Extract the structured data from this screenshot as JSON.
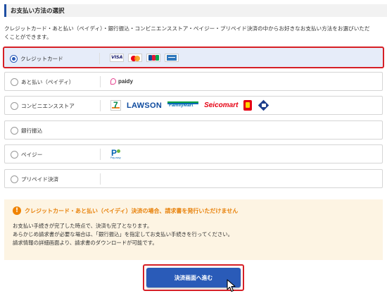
{
  "section": {
    "title": "お支払い方法の選択"
  },
  "intro": {
    "line1": "クレジットカード・あと払い（ペイディ）・銀行振込・コンビニエンスストア・ペイジー・プリペイド決済の中からお好きなお支払い方法をお選びいただ",
    "line2": "くことができます。"
  },
  "payment_options": [
    {
      "label": "クレジットカード",
      "selected": true,
      "logos": [
        "visa-icon",
        "mastercard-icon",
        "jcb-icon",
        "amex-icon"
      ]
    },
    {
      "label": "あと払い（ペイディ）",
      "selected": false,
      "logos": [
        "paidy-logo"
      ],
      "logo_text": "paidy"
    },
    {
      "label": "コンビニエンスストア",
      "selected": false,
      "logos": [
        "seven-eleven-logo",
        "lawson-logo",
        "familymart-logo",
        "seicomart-logo",
        "daily-yamazaki-logo",
        "ministop-logo"
      ],
      "lawson_text": "LAWSON",
      "famima_text": "FamilyMart",
      "seico_text": "Seicomart",
      "seven_text": "7"
    },
    {
      "label": "銀行振込",
      "selected": false
    },
    {
      "label": "ペイジー",
      "selected": false,
      "logos": [
        "payeasy-logo"
      ]
    },
    {
      "label": "プリペイド決済",
      "selected": false
    }
  ],
  "notice": {
    "icon": "!",
    "title": "クレジットカード・あと払い（ペイディ）決済の場合、請求書を発行いただけません",
    "lines": [
      "お支払い手続きが完了した時点で、決済も完了となります。",
      "あらかじめ請求書が必要な場合は、「銀行振込」を指定してお支払い手続きを行ってください。",
      "請求情報の詳細画面より、請求書のダウンロードが可能です。"
    ]
  },
  "proceed_button": {
    "label": "決済画面へ進む"
  },
  "colors": {
    "accent": "#2a5bb8",
    "highlight": "#d61f26",
    "notice_bg": "#fdf4e3",
    "notice_title": "#e8820c"
  }
}
